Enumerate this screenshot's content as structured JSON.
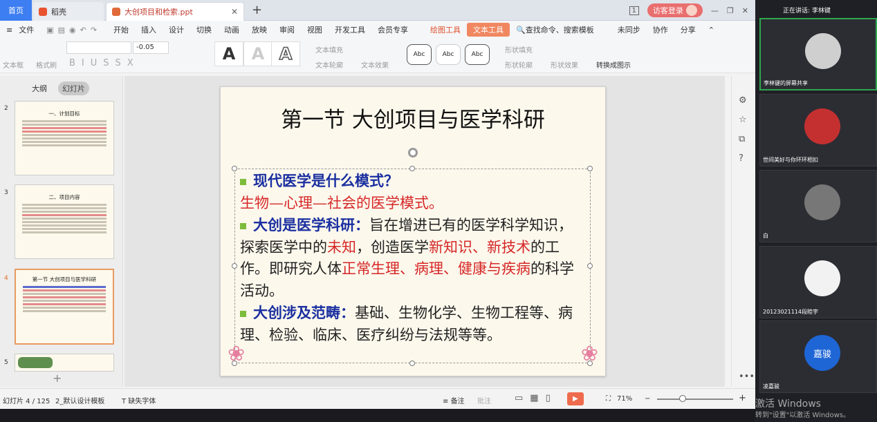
{
  "tabs": {
    "home": "首页",
    "daoke": "稻壳",
    "doc": "大创项目和检索.ppt"
  },
  "titlebar": {
    "page_badge": "1",
    "visitor_login": "访客登录"
  },
  "menu": {
    "file": "文件",
    "items": [
      "开始",
      "插入",
      "设计",
      "切换",
      "动画",
      "放映",
      "审阅",
      "视图",
      "开发工具",
      "会员专享"
    ],
    "drawing_tools": "绘图工具",
    "text_tools": "文本工具",
    "search": "查找命令、搜索模板",
    "unsynced": "未同步",
    "collab": "协作",
    "share": "分享"
  },
  "toolbar": {
    "textbox": "文本框",
    "format_painter": "格式刷",
    "font_size_delta": "-0.05",
    "text_fill": "文本填充",
    "text_outline": "文本轮廓",
    "text_effect": "文本效果",
    "abc1": "Abc",
    "abc2": "Abc",
    "abc3": "Abc",
    "shape_fill": "形状填充",
    "shape_outline": "形状轮廓",
    "shape_effect": "形状效果",
    "convert_chart": "转换成图示"
  },
  "left_panel": {
    "outline_tab": "大纲",
    "slides_tab": "幻灯片",
    "thumbs": [
      {
        "num": "2",
        "title": "一、计划目标"
      },
      {
        "num": "3",
        "title": "二、项目内容"
      },
      {
        "num": "4",
        "title": "第一节 大创项目与医学科研"
      },
      {
        "num": "5",
        "title": ""
      }
    ]
  },
  "slide": {
    "title": "第一节 大创项目与医学科研",
    "b1_head": "现代医学是什么模式？",
    "b1_text": "生物—心理—社会的医学模式。",
    "b2_head": "大创是医学科研：",
    "b2_t1": "旨在增进已有的医学科学知识，探索医学中的",
    "b2_red1": "未知",
    "b2_t2": "，创造医学",
    "b2_red2": "新知识、新技术",
    "b2_t3": "的工作。即研究人体",
    "b2_red3": "正常生理、病理、健康与疾病",
    "b2_t4": "的科学活动。",
    "b3_head": "大创涉及范畴：",
    "b3_text": "基础、生物化学、生物工程等、病理、检验、临床、医疗纠纷与法规等等。"
  },
  "status": {
    "slide_count": "幻灯片 4 / 125",
    "template": "2_默认设计模板",
    "missing_font": "缺失字体",
    "notes": "备注",
    "annotate": "批注",
    "zoom": "71%"
  },
  "meeting": {
    "speaking": "正在讲话: 李林键",
    "participants": [
      {
        "name": "李林键的屏幕共享",
        "active": true,
        "color": "#cfcfcf"
      },
      {
        "name": "世间美好与你环环相扣",
        "active": false,
        "color": "#c43030"
      },
      {
        "name": "白",
        "active": false,
        "color": "#777"
      },
      {
        "name": "20123021114段睦宇",
        "active": false,
        "color": "#f2f2f2"
      },
      {
        "name": "凌嘉骏",
        "active": false,
        "color": "#1e66d6",
        "initials": "嘉骏"
      }
    ]
  },
  "watermark": {
    "line1": "激活 Windows",
    "line2": "转到\"设置\"以激活 Windows。"
  }
}
